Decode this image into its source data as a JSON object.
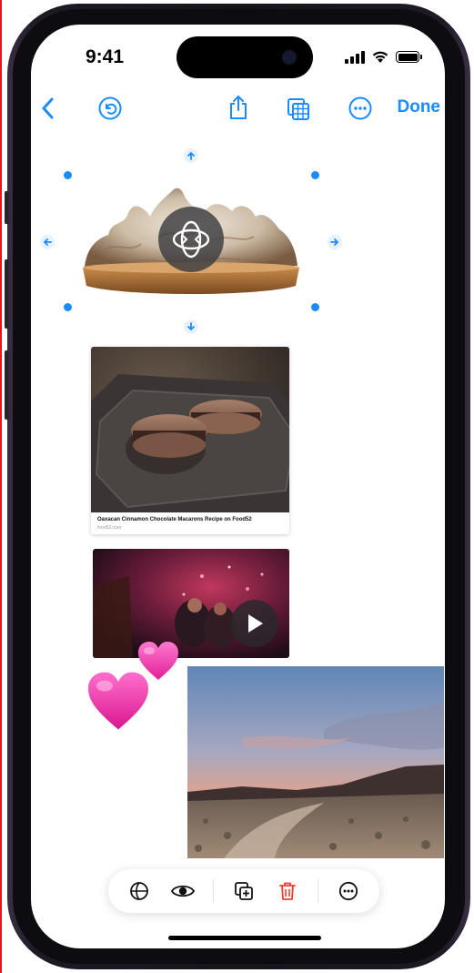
{
  "status_bar": {
    "time": "9:41",
    "icons": [
      "cellular-signal-icon",
      "wifi-icon",
      "battery-icon"
    ]
  },
  "toolbar": {
    "back_icon": "chevron-left-icon",
    "undo_icon": "undo-circle-icon",
    "share_icon": "share-icon",
    "gallery_icon": "layers-grid-icon",
    "more_icon": "ellipsis-circle-icon",
    "done_label": "Done",
    "accent": "#1a8cff"
  },
  "canvas": {
    "selected_item": {
      "name": "meringue-tart-cutout",
      "rotate_icon": "rotate-3d-icon"
    },
    "link_card": {
      "title": "Oaxacan Cinnamon Chocolate Macarons Recipe on Food52",
      "source": "food52.com"
    },
    "video": {
      "play_icon": "play-icon"
    },
    "stickers": [
      "pink-heart-icon",
      "pink-heart-icon"
    ],
    "photo": {
      "subject": "desert-sunset"
    }
  },
  "bottom_toolbar": {
    "items": [
      {
        "icon": "globe-icon",
        "name": "background-removal"
      },
      {
        "icon": "eye-icon",
        "name": "view"
      },
      {
        "icon": "duplicate-icon",
        "name": "duplicate"
      },
      {
        "icon": "trash-icon",
        "name": "delete",
        "color": "#ff3b30"
      },
      {
        "icon": "ellipsis-circle-icon",
        "name": "more"
      }
    ]
  }
}
